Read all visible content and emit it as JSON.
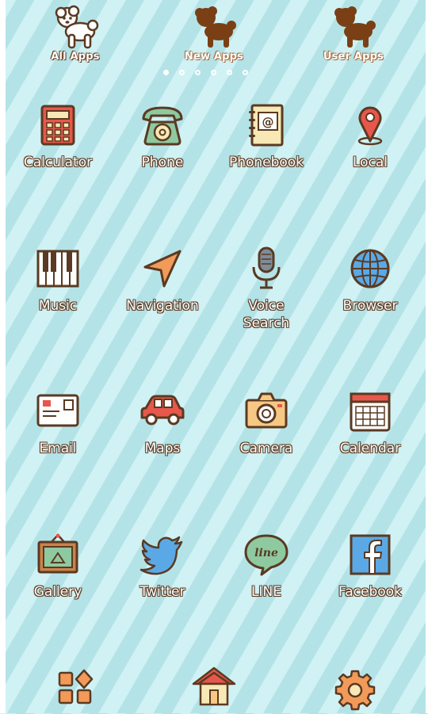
{
  "top_tabs": [
    {
      "label": "All Apps",
      "icon": "white-dog-icon"
    },
    {
      "label": "New Apps",
      "icon": "brown-dog-icon"
    },
    {
      "label": "User Apps",
      "icon": "brown-dog-icon"
    }
  ],
  "page_indicator": {
    "count": 6,
    "active": 0
  },
  "apps": [
    {
      "label": "Calculator",
      "icon": "calculator-icon"
    },
    {
      "label": "Phone",
      "icon": "phone-icon"
    },
    {
      "label": "Phonebook",
      "icon": "phonebook-icon"
    },
    {
      "label": "Local",
      "icon": "map-pin-icon"
    },
    {
      "label": "Music",
      "icon": "piano-keys-icon"
    },
    {
      "label": "Navigation",
      "icon": "navigation-arrow-icon"
    },
    {
      "label": "Voice\nSearch",
      "icon": "microphone-icon"
    },
    {
      "label": "Browser",
      "icon": "globe-icon"
    },
    {
      "label": "Email",
      "icon": "envelope-icon"
    },
    {
      "label": "Maps",
      "icon": "car-icon"
    },
    {
      "label": "Camera",
      "icon": "camera-icon"
    },
    {
      "label": "Calendar",
      "icon": "calendar-icon"
    },
    {
      "label": "Gallery",
      "icon": "picture-frame-icon"
    },
    {
      "label": "Twitter",
      "icon": "twitter-bird-icon"
    },
    {
      "label": "LINE",
      "icon": "line-bubble-icon"
    },
    {
      "label": "Facebook",
      "icon": "facebook-icon"
    }
  ],
  "dock": [
    {
      "icon": "app-drawer-icon"
    },
    {
      "icon": "home-icon"
    },
    {
      "icon": "settings-gear-icon"
    }
  ],
  "colors": {
    "background": "#c6edf0",
    "stripe": "#b4e3e7",
    "outline": "#6b3a1f",
    "accent_red": "#e8574b",
    "accent_green": "#8fc9a0",
    "accent_blue": "#5aa9e6"
  }
}
